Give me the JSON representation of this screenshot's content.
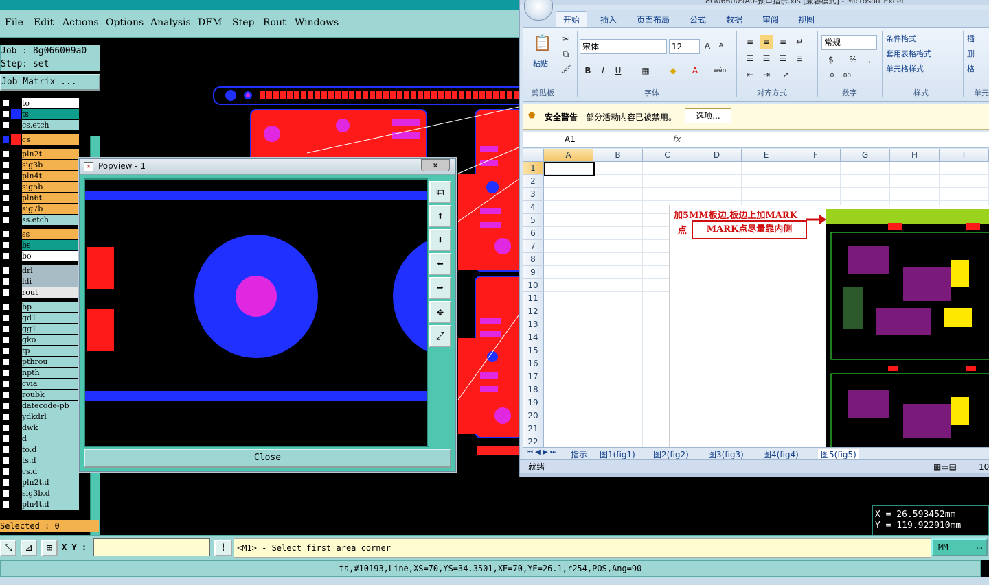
{
  "genesis": {
    "menu": [
      "File",
      "Edit",
      "Actions",
      "Options",
      "Analysis",
      "DFM",
      "Step",
      "Rout",
      "Windows"
    ],
    "job_label": "Job : 8g066009a0",
    "step_label": "Step: set",
    "job_matrix_label": "Job Matrix ...",
    "layers": [
      {
        "name": "to",
        "color": "#ffffff"
      },
      {
        "name": "ts",
        "color": "#109e8c",
        "swatch": "#1a2dff"
      },
      {
        "name": "cs.etch",
        "color": "#9ed6d3"
      },
      {
        "name": "cs",
        "color": "#f3b24d",
        "swatch": "#ff2020",
        "active": true
      },
      {
        "name": "pln2t",
        "color": "#f3b24d"
      },
      {
        "name": "sig3b",
        "color": "#f3b24d"
      },
      {
        "name": "pln4t",
        "color": "#f3b24d"
      },
      {
        "name": "sig5b",
        "color": "#f3b24d"
      },
      {
        "name": "pln6t",
        "color": "#f3b24d"
      },
      {
        "name": "sig7b",
        "color": "#f3b24d"
      },
      {
        "name": "ss.etch",
        "color": "#9ed6d3"
      },
      {
        "name": "ss",
        "color": "#f3b24d"
      },
      {
        "name": "bs",
        "color": "#109e8c"
      },
      {
        "name": "bo",
        "color": "#ffffff"
      },
      {
        "name": "drl",
        "color": "#a7bcc4"
      },
      {
        "name": "ldi",
        "color": "#a7bcc4"
      },
      {
        "name": "rout",
        "color": "#e7e7e7"
      },
      {
        "name": "bp",
        "color": "#9ed6d3"
      },
      {
        "name": "gd1",
        "color": "#9ed6d3"
      },
      {
        "name": "gg1",
        "color": "#9ed6d3"
      },
      {
        "name": "gko",
        "color": "#9ed6d3"
      },
      {
        "name": "tp",
        "color": "#9ed6d3"
      },
      {
        "name": "pthrou",
        "color": "#9ed6d3"
      },
      {
        "name": "npth",
        "color": "#9ed6d3"
      },
      {
        "name": "cvia",
        "color": "#9ed6d3"
      },
      {
        "name": "roubk",
        "color": "#9ed6d3"
      },
      {
        "name": "datecode-pb",
        "color": "#9ed6d3"
      },
      {
        "name": "ydkdrl",
        "color": "#9ed6d3"
      },
      {
        "name": "dwk",
        "color": "#9ed6d3"
      },
      {
        "name": "d",
        "color": "#9ed6d3"
      },
      {
        "name": "to.d",
        "color": "#9ed6d3"
      },
      {
        "name": "ts.d",
        "color": "#9ed6d3"
      },
      {
        "name": "cs.d",
        "color": "#9ed6d3"
      },
      {
        "name": "pln2t.d",
        "color": "#9ed6d3"
      },
      {
        "name": "sig3b.d",
        "color": "#9ed6d3"
      },
      {
        "name": "pln4t.d",
        "color": "#9ed6d3"
      }
    ],
    "selected_label": "Selected : 0",
    "coord_x": "X = 26.593452mm",
    "coord_y": "Y = 119.922910mm",
    "xy_label": "X Y :",
    "xy_input_value": "",
    "bang_label": "!",
    "prompt": "<M1> - Select first area corner",
    "unit": "MM",
    "status_line": "ts,#10193,Line,XS=70,YS=34.3501,XE=70,YE=26.1,r254,POS,Ang=90"
  },
  "popview": {
    "title": "Popview - 1",
    "close_x": "×",
    "close_label": "Close",
    "tool_icons": [
      "zoom-window-icon",
      "pan-up-icon",
      "pan-down-icon",
      "pan-left-icon",
      "pan-right-icon",
      "zoom-fit-icon",
      "zoom-home-icon"
    ],
    "tool_glyphs": [
      "⧉",
      "⬆",
      "⬇",
      "⬅",
      "➡",
      "✥",
      "⤢"
    ]
  },
  "excel": {
    "title": "8G066009A0-预审指示.xls [兼容模式] - Microsoft Excel",
    "tabs": [
      "开始",
      "插入",
      "页面布局",
      "公式",
      "数据",
      "审阅",
      "视图"
    ],
    "groups": [
      "剪贴板",
      "字体",
      "对齐方式",
      "数字",
      "样式",
      "单元"
    ],
    "paste_label": "粘贴",
    "font_name": "宋体",
    "font_size": "12",
    "number_format": "常规",
    "styles": [
      "条件格式",
      "套用表格格式",
      "单元格样式"
    ],
    "cells_btns": [
      "插",
      "删",
      "格"
    ],
    "security_title": "安全警告",
    "security_text": "部分活动内容已被禁用。",
    "security_btn": "选项...",
    "name_box": "A1",
    "fx": "fx",
    "columns": [
      "A",
      "B",
      "C",
      "D",
      "E",
      "F",
      "G",
      "H",
      "I"
    ],
    "rows": [
      "1",
      "2",
      "3",
      "4",
      "5",
      "6",
      "7",
      "8",
      "9",
      "10",
      "11",
      "12",
      "13",
      "14",
      "15",
      "16",
      "17",
      "18",
      "19",
      "20",
      "21",
      "22"
    ],
    "annotation_line1": "加5MM板边,板边上加MARK",
    "annotation_dot": "点",
    "annotation_box": "MARK点尽量靠内侧",
    "sheet_tabs": [
      "指示",
      "图1(fig1)",
      "图2(fig2)",
      "图3(fig3)",
      "图4(fig4)",
      "图5(fig5)"
    ],
    "status_ready": "就绪",
    "zoom": "10"
  }
}
